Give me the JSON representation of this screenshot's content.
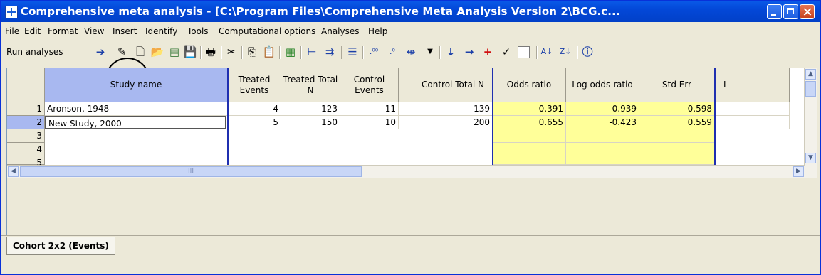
{
  "window": {
    "title": "Comprehensive meta analysis - [C:\\Program Files\\Comprehensive Meta Analysis Version 2\\BCG.c..."
  },
  "menu": [
    "File",
    "Edit",
    "Format",
    "View",
    "Insert",
    "Identify",
    "Tools",
    "Computational options",
    "Analyses",
    "Help"
  ],
  "toolbar": {
    "run_label": "Run analyses",
    "icons": [
      "arrow-right-icon",
      "pin-icon",
      "new-file-icon",
      "open-folder-icon",
      "open-data-icon",
      "save-icon",
      "print-icon",
      "cut-icon",
      "copy-icon",
      "paste-icon",
      "wizard-icon",
      "indent-left-icon",
      "indent-right-icon",
      "align-icon",
      "decimal-increase-icon",
      "decimal-decrease-icon",
      "column-width-icon",
      "dropdown-icon",
      "arrow-down-icon",
      "arrow-right-blue-icon",
      "plus-red-icon",
      "check-icon",
      "checkbox-icon",
      "sort-asc-icon",
      "sort-desc-icon",
      "info-icon"
    ]
  },
  "grid": {
    "headers": [
      "Study name",
      "Treated Events",
      "Treated Total N",
      "Control Events",
      "Control Total N",
      "Odds ratio",
      "Log odds ratio",
      "Std Err",
      "I"
    ],
    "row_numbers": [
      "1",
      "2",
      "3",
      "4",
      "5"
    ],
    "rows": [
      [
        "Aronson, 1948",
        "4",
        "123",
        "11",
        "139",
        "0.391",
        "-0.939",
        "0.598",
        ""
      ],
      [
        "New Study, 2000",
        "5",
        "150",
        "10",
        "200",
        "0.655",
        "-0.423",
        "0.559",
        ""
      ]
    ],
    "scroll_thumb_label": "III"
  },
  "tabs": [
    "Cohort 2x2 (Events)"
  ]
}
